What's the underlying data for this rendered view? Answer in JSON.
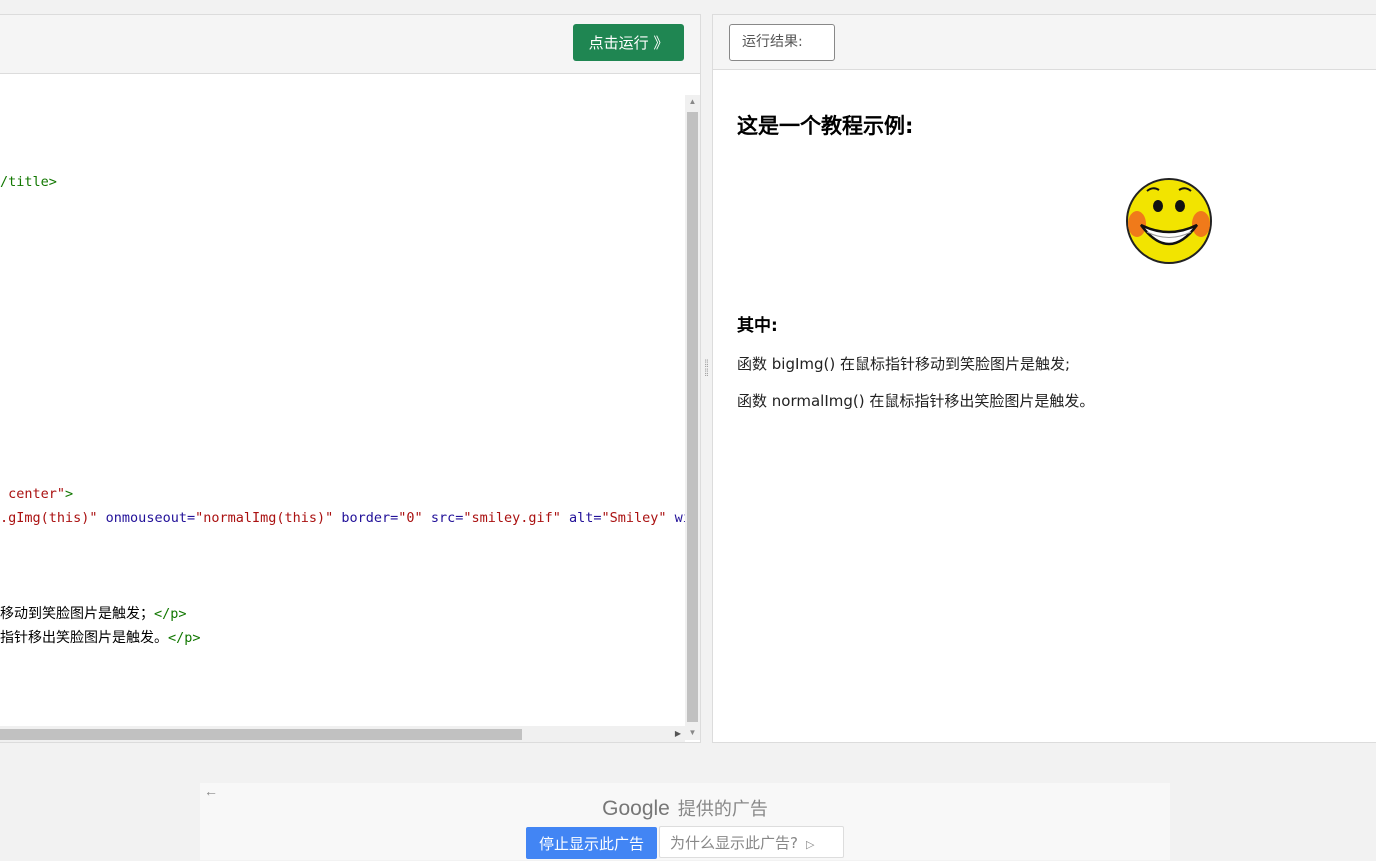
{
  "editor": {
    "run_button_label": "点击运行 》",
    "code_lines": [
      {
        "parts": [
          {
            "cls": "tag",
            "text": "/title>"
          }
        ]
      },
      {
        "parts": [
          {
            "cls": "str",
            "text": " center\""
          },
          {
            "cls": "tag",
            "text": ">"
          }
        ]
      },
      {
        "parts": [
          {
            "cls": "str",
            "text": ".gImg(this)\""
          },
          {
            "cls": "attr",
            "text": " onmouseout="
          },
          {
            "cls": "str",
            "text": "\"normalImg(this)\""
          },
          {
            "cls": "attr",
            "text": " border="
          },
          {
            "cls": "str",
            "text": "\"0\""
          },
          {
            "cls": "attr",
            "text": " src="
          },
          {
            "cls": "str",
            "text": "\"smiley.gif\""
          },
          {
            "cls": "attr",
            "text": " alt="
          },
          {
            "cls": "str",
            "text": "\"Smiley\""
          },
          {
            "cls": "attr",
            "text": " wid"
          }
        ]
      },
      {
        "parts": [
          {
            "cls": "txt",
            "text": "移动到笑脸图片是触发；"
          },
          {
            "cls": "tag",
            "text": "</p>"
          }
        ]
      },
      {
        "parts": [
          {
            "cls": "txt",
            "text": "指针移出笑脸图片是触发。"
          },
          {
            "cls": "tag",
            "text": "</p>"
          }
        ]
      }
    ]
  },
  "result": {
    "label": "运行结果:",
    "heading": "这是一个教程示例:",
    "subheading": "其中:",
    "paragraphs": [
      "函数 bigImg() 在鼠标指针移动到笑脸图片是触发;",
      "函数 normalImg() 在鼠标指针移出笑脸图片是触发。"
    ],
    "image_icon": "smiley-face"
  },
  "ad": {
    "provider_brand": "Google",
    "provider_text": "提供的广告",
    "stop_label": "停止显示此广告",
    "why_label": "为什么显示此广告?",
    "back_icon": "arrow-left-icon"
  }
}
